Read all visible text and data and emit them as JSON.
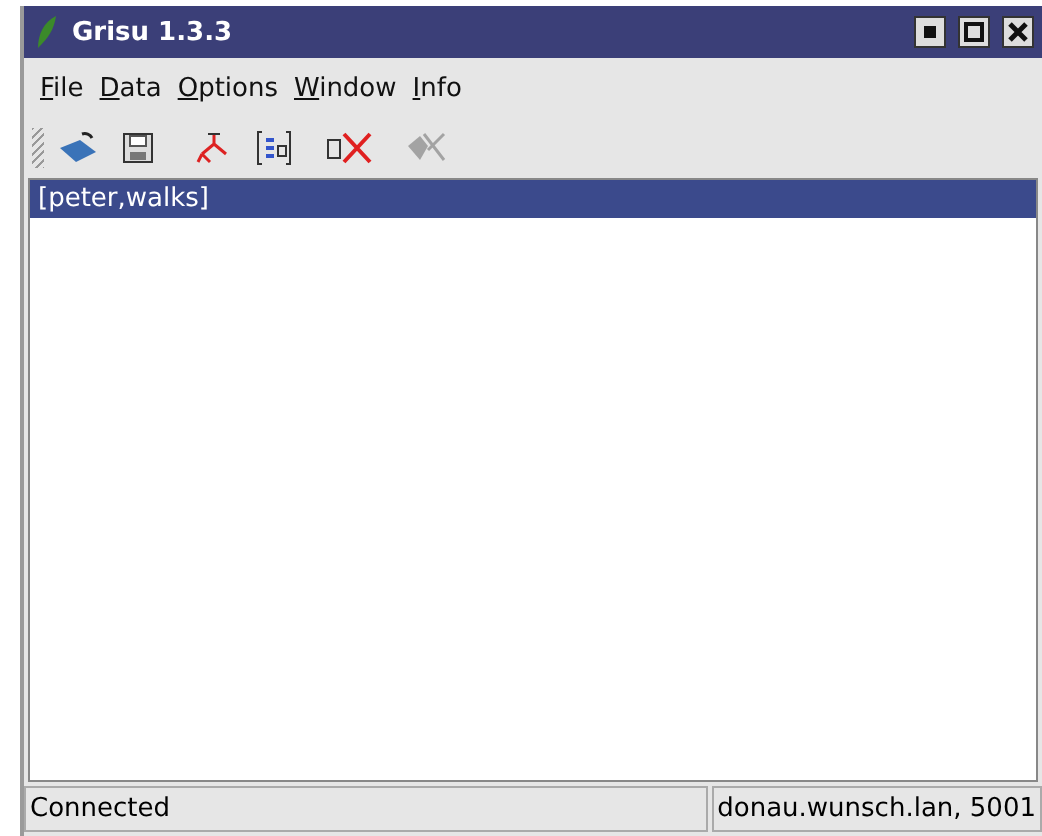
{
  "window": {
    "title": "Grisu 1.3.3"
  },
  "menu": [
    "File",
    "Data",
    "Options",
    "Window",
    "Info"
  ],
  "toolbar": [
    {
      "kind": "open",
      "disabled": false
    },
    {
      "kind": "save",
      "disabled": false
    },
    {
      "kind": "tree",
      "disabled": false
    },
    {
      "kind": "list",
      "disabled": false
    },
    {
      "kind": "delete",
      "disabled": false
    },
    {
      "kind": "remove",
      "disabled": true
    }
  ],
  "list": [
    {
      "label": "[peter,walks]",
      "selected": true
    }
  ],
  "status_bar": {
    "status": "Connected",
    "server": "donau.wunsch.lan, 5001"
  }
}
